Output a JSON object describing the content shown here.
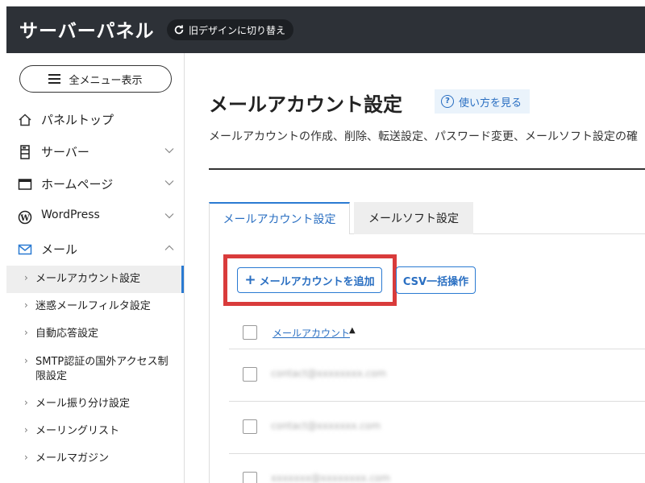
{
  "header": {
    "brand": "サーバーパネル",
    "switch_label": "旧デザインに切り替え"
  },
  "sidebar": {
    "menu_button": "全メニュー表示",
    "top_items": [
      {
        "label": "パネルトップ",
        "icon": "home-icon",
        "has_chevron": false
      },
      {
        "label": "サーバー",
        "icon": "server-icon",
        "has_chevron": true,
        "chevron": "down"
      },
      {
        "label": "ホームページ",
        "icon": "browser-window-icon",
        "has_chevron": true,
        "chevron": "down"
      },
      {
        "label": "WordPress",
        "icon": "wordpress-icon",
        "has_chevron": true,
        "chevron": "down"
      },
      {
        "label": "メール",
        "icon": "mail-icon",
        "has_chevron": true,
        "chevron": "up"
      }
    ],
    "sub_items": [
      {
        "label": "メールアカウント設定",
        "active": true
      },
      {
        "label": "迷惑メールフィルタ設定"
      },
      {
        "label": "自動応答設定"
      },
      {
        "label": "SMTP認証の国外アクセス制限設定"
      },
      {
        "label": "メール振り分け設定"
      },
      {
        "label": "メーリングリスト"
      },
      {
        "label": "メールマガジン"
      }
    ]
  },
  "main": {
    "title": "メールアカウント設定",
    "help_label": "使い方を見る",
    "description": "メールアカウントの作成、削除、転送設定、パスワード変更、メールソフト設定の確",
    "tabs": [
      {
        "label": "メールアカウント設定",
        "active": true
      },
      {
        "label": "メールソフト設定",
        "active": false
      }
    ],
    "add_button": "メールアカウントを追加",
    "csv_button": "CSV一括操作",
    "table": {
      "column_header": "メールアカウント",
      "sort_indicator": "▲",
      "rows": [
        {
          "account": "contact@xxxxxxxx.com"
        },
        {
          "account": "contact@xxxxxxx.com"
        },
        {
          "account": "xxxxxxx@xxxxxxxx.com"
        }
      ]
    }
  },
  "colors": {
    "header_bg": "#2d3137",
    "accent": "#2a7ad2",
    "highlight": "#d93b3b"
  }
}
